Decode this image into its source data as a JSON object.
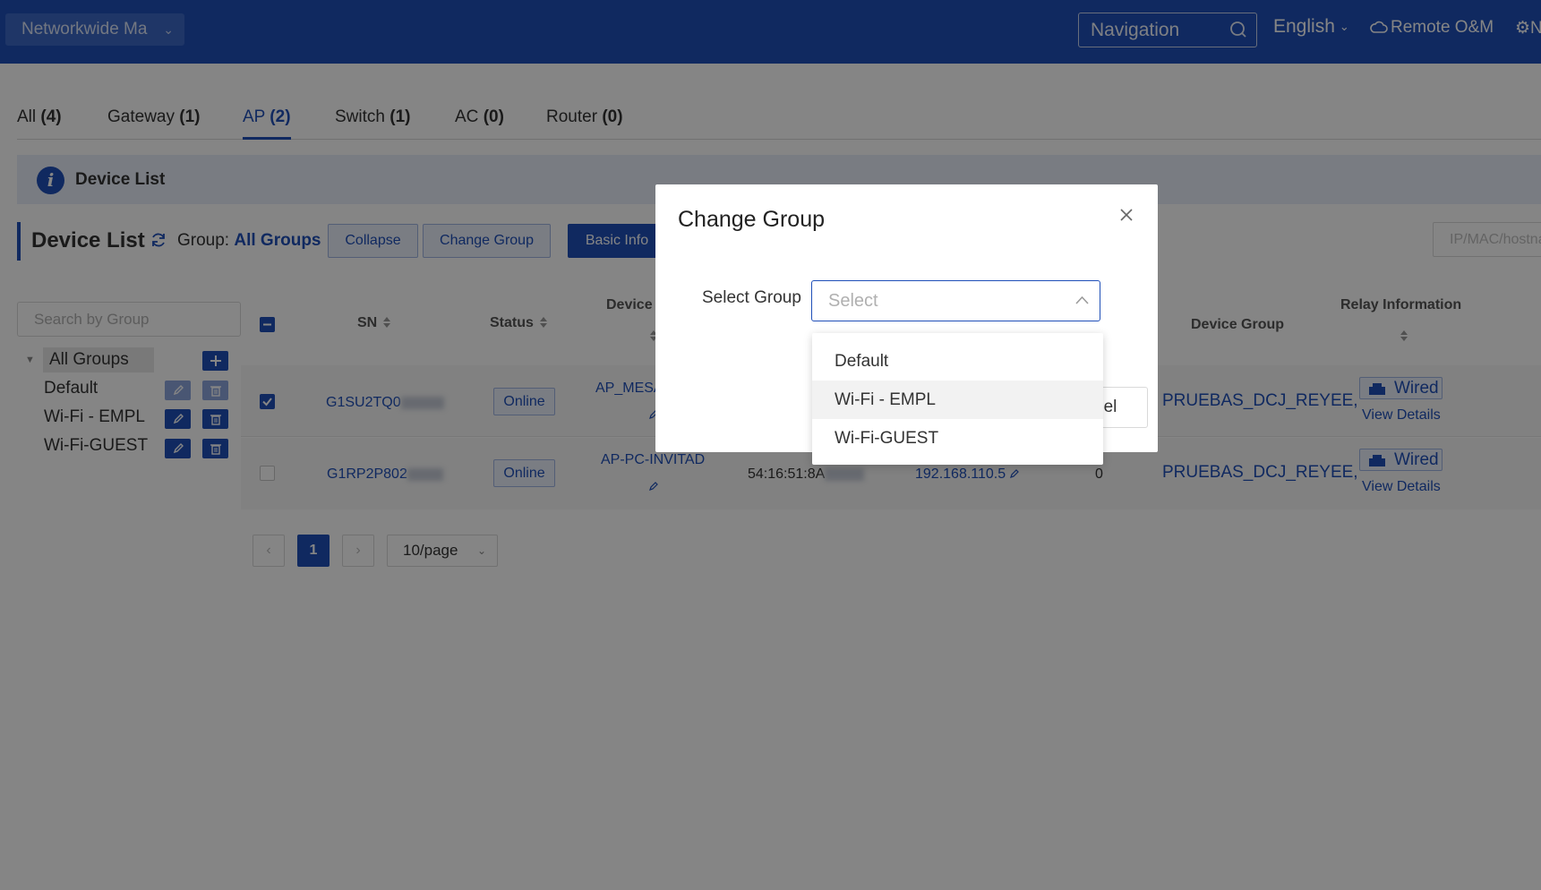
{
  "topbar": {
    "scope": "Networkwide Ma",
    "nav_placeholder": "Navigation",
    "language": "English",
    "remote": "Remote O&M",
    "more": "N"
  },
  "tabs": [
    {
      "label": "All",
      "count": "(4)"
    },
    {
      "label": "Gateway",
      "count": "(1)"
    },
    {
      "label": "AP",
      "count": "(2)"
    },
    {
      "label": "Switch",
      "count": "(1)"
    },
    {
      "label": "AC",
      "count": "(0)"
    },
    {
      "label": "Router",
      "count": "(0)"
    }
  ],
  "banner": {
    "text": "Device List"
  },
  "device_list": {
    "title": "Device List",
    "group_prefix": "Group:",
    "group_value": "All Groups",
    "collapse": "Collapse",
    "change_group": "Change Group",
    "basic_info": "Basic Info",
    "ip_search_placeholder": "IP/MAC/hostname"
  },
  "groups": {
    "search_placeholder": "Search by Group",
    "all": "All Groups",
    "items": [
      "Default",
      "Wi-Fi - EMPL",
      "Wi-Fi-GUEST"
    ]
  },
  "table": {
    "headers": {
      "sn": "SN",
      "status": "Status",
      "device": "Device",
      "device_group": "Device Group",
      "relay": "Relay Information"
    },
    "rows": [
      {
        "sn": "G1SU2TQ0",
        "status": "Online",
        "device": "AP_MESA",
        "mac": "",
        "ip": "",
        "clients": "",
        "group": "PRUEBAS_DCJ_REYEE,",
        "relay": "Wired",
        "details": "View Details"
      },
      {
        "sn": "G1RP2P802",
        "status": "Online",
        "device": "AP-PC-INVITAD",
        "mac": "54:16:51:8A",
        "ip": "192.168.110.5",
        "clients": "0",
        "group": "PRUEBAS_DCJ_REYEE,",
        "relay": "Wired",
        "details": "View Details"
      }
    ]
  },
  "pagination": {
    "current": "1",
    "page_size": "10/page"
  },
  "modal": {
    "title": "Change Group",
    "field_label": "Select Group",
    "select_placeholder": "Select",
    "cancel": "el",
    "options": [
      "Default",
      "Wi-Fi - EMPL",
      "Wi-Fi-GUEST"
    ]
  },
  "colors": {
    "brand": "#1f4fb8",
    "overlay": "rgba(0,0,0,0.48)"
  }
}
